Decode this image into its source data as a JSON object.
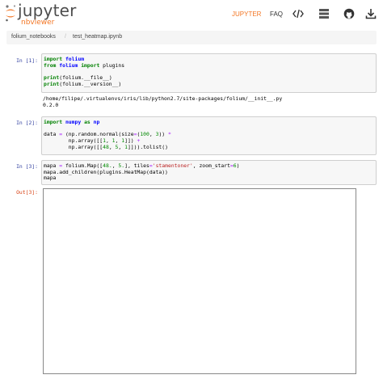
{
  "header": {
    "logo_word": "jupyter",
    "logo_sub": "nbviewer",
    "nav_jupyter": "JUPYTER",
    "nav_faq": "FAQ",
    "icons": [
      "code-icon",
      "server-icon",
      "github-icon",
      "download-icon"
    ],
    "accent_color": "#f37726"
  },
  "breadcrumb": {
    "items": [
      "folium_notebooks",
      "test_heatmap.ipynb"
    ],
    "separator": "/"
  },
  "cells": [
    {
      "prompt": "In [1]:",
      "code_lines": [
        [
          [
            "kw",
            "import"
          ],
          [
            "",
            " "
          ],
          [
            "mod",
            "folium"
          ]
        ],
        [
          [
            "kw",
            "from"
          ],
          [
            "",
            " "
          ],
          [
            "mod",
            "folium"
          ],
          [
            "",
            " "
          ],
          [
            "kw",
            "import"
          ],
          [
            "",
            " plugins"
          ]
        ],
        [
          [
            "",
            ""
          ]
        ],
        [
          [
            "kw",
            "print"
          ],
          [
            "",
            "(folium."
          ],
          [
            "",
            "__file__"
          ],
          [
            "",
            ")"
          ]
        ],
        [
          [
            "kw",
            "print"
          ],
          [
            "",
            "(folium."
          ],
          [
            "",
            "__version__"
          ],
          [
            "",
            ")"
          ]
        ]
      ],
      "output": [
        "/home/filipe/.virtualenvs/iris/lib/python2.7/site-packages/folium/__init__.py",
        "0.2.0"
      ]
    },
    {
      "prompt": "In [2]:",
      "code_lines": [
        [
          [
            "kw",
            "import"
          ],
          [
            "",
            " "
          ],
          [
            "mod",
            "numpy"
          ],
          [
            "",
            " "
          ],
          [
            "kw",
            "as"
          ],
          [
            "",
            " "
          ],
          [
            "mod",
            "np"
          ]
        ],
        [
          [
            "",
            ""
          ]
        ],
        [
          [
            "",
            "data "
          ],
          [
            "op",
            "="
          ],
          [
            "",
            " (np.random.normal(size"
          ],
          [
            "op",
            "="
          ],
          [
            "",
            "("
          ],
          [
            "num",
            "100"
          ],
          [
            "",
            ", "
          ],
          [
            "num",
            "3"
          ],
          [
            "",
            ")) "
          ],
          [
            "op",
            "*"
          ]
        ],
        [
          [
            "",
            "        np.array([["
          ],
          [
            "num",
            "1"
          ],
          [
            "",
            ", "
          ],
          [
            "num",
            "1"
          ],
          [
            "",
            ", "
          ],
          [
            "num",
            "1"
          ],
          [
            "",
            "]]) "
          ],
          [
            "op",
            "+"
          ]
        ],
        [
          [
            "",
            "        np.array([["
          ],
          [
            "num",
            "48"
          ],
          [
            "",
            ", "
          ],
          [
            "num",
            "5"
          ],
          [
            "",
            ", "
          ],
          [
            "num",
            "1"
          ],
          [
            "",
            "]])).tolist()"
          ]
        ]
      ],
      "output": []
    },
    {
      "prompt": "In [3]:",
      "code_lines": [
        [
          [
            "",
            "mapa "
          ],
          [
            "op",
            "="
          ],
          [
            "",
            " folium.Map(["
          ],
          [
            "num",
            "48."
          ],
          [
            "",
            ", "
          ],
          [
            "num",
            "5."
          ],
          [
            "",
            "], tiles"
          ],
          [
            "op",
            "="
          ],
          [
            "str",
            "'stamentoner'"
          ],
          [
            "",
            ", zoom_start"
          ],
          [
            "op",
            "="
          ],
          [
            "num",
            "6"
          ],
          [
            "",
            ")"
          ]
        ],
        [
          [
            "",
            "mapa.add_children(plugins.HeatMap(data))"
          ]
        ],
        [
          [
            "",
            "mapa"
          ]
        ]
      ],
      "output": []
    }
  ],
  "out_prompt": "Out[3]:"
}
